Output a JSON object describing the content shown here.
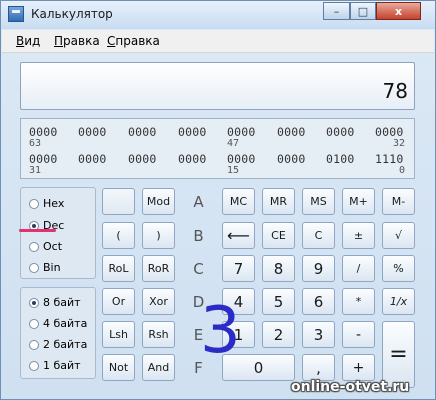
{
  "window": {
    "title": "Калькулятор",
    "min_glyph": "–",
    "max_glyph": "□",
    "close_glyph": "x"
  },
  "menu": {
    "view_first": "В",
    "view_rest": "ид",
    "edit_first": "П",
    "edit_rest": "равка",
    "help_first": "С",
    "help_rest": "правка"
  },
  "display": {
    "value": "78"
  },
  "bits": {
    "row1": [
      "0000",
      "0000",
      "0000",
      "0000",
      "0000",
      "0000",
      "0000",
      "0000"
    ],
    "row1_idx": [
      "63",
      "47",
      "32"
    ],
    "row2": [
      "0000",
      "0000",
      "0000",
      "0000",
      "0000",
      "0000",
      "0100",
      "1110"
    ],
    "row2_idx": [
      "31",
      "15",
      "0"
    ]
  },
  "radix": {
    "hex": "Hex",
    "dec": "Dec",
    "oct": "Oct",
    "bin": "Bin",
    "selected": "Dec"
  },
  "wordsize": {
    "qword": "8 байт",
    "dword": "4 байта",
    "word": "2 байта",
    "byte": "1 байт",
    "selected": "8 байт"
  },
  "keys": {
    "mod": "Mod",
    "a": "A",
    "mc": "MC",
    "mr": "MR",
    "ms": "MS",
    "mplus": "M+",
    "mminus": "M-",
    "lparen": "(",
    "rparen": ")",
    "b": "B",
    "back": "⟵",
    "ce": "CE",
    "c": "C",
    "plusminus": "±",
    "sqrt": "√",
    "rol": "RoL",
    "ror": "RoR",
    "c_hex": "C",
    "k7": "7",
    "k8": "8",
    "k9": "9",
    "div": "/",
    "pct": "%",
    "or": "Or",
    "xor": "Xor",
    "d": "D",
    "k4": "4",
    "k5": "5",
    "k6": "6",
    "mul": "*",
    "recip": "1/x",
    "lsh": "Lsh",
    "rsh": "Rsh",
    "e": "E",
    "k1": "1",
    "k2": "2",
    "k3": "3",
    "minus": "-",
    "eq": "=",
    "not": "Not",
    "and": "And",
    "f": "F",
    "k0": "0",
    "dot": ",",
    "plus": "+"
  },
  "overlay": {
    "big_digit": "3",
    "watermark": "online-otvet.ru"
  },
  "colors": {
    "highlight": "#e2326f",
    "overlay_digit": "#2b2bc8"
  }
}
